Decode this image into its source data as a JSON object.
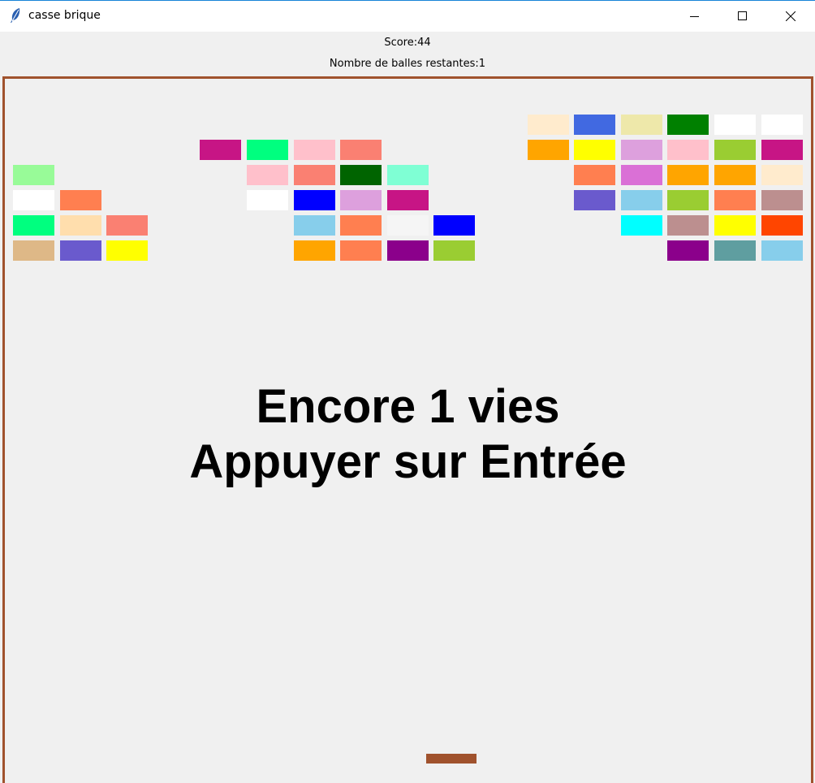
{
  "window": {
    "title": "casse brique",
    "app_icon": "feather-icon",
    "controls": [
      "minimize-icon",
      "maximize-icon",
      "close-icon"
    ]
  },
  "hud": {
    "score": "Score:44",
    "balls_remaining": "Nombre de balles restantes:1"
  },
  "message": {
    "line1": "Encore 1 vies",
    "line2": "Appuyer sur Entrée"
  },
  "colors": {
    "border": "#a0522d",
    "paddle": "#a0522d",
    "background": "#f0f0f0"
  },
  "bricks": [
    {
      "row": 0,
      "col": 11,
      "color": "#ffebcd"
    },
    {
      "row": 0,
      "col": 12,
      "color": "#4169e1"
    },
    {
      "row": 0,
      "col": 13,
      "color": "#eee8aa"
    },
    {
      "row": 0,
      "col": 14,
      "color": "#008000"
    },
    {
      "row": 0,
      "col": 15,
      "color": "#ffffff"
    },
    {
      "row": 0,
      "col": 16,
      "color": "#ffffff"
    },
    {
      "row": 1,
      "col": 4,
      "color": "#c71585"
    },
    {
      "row": 1,
      "col": 5,
      "color": "#00ff7f"
    },
    {
      "row": 1,
      "col": 6,
      "color": "#ffc0cb"
    },
    {
      "row": 1,
      "col": 7,
      "color": "#fa8072"
    },
    {
      "row": 1,
      "col": 11,
      "color": "#ffa500"
    },
    {
      "row": 1,
      "col": 12,
      "color": "#ffff00"
    },
    {
      "row": 1,
      "col": 13,
      "color": "#dda0dd"
    },
    {
      "row": 1,
      "col": 14,
      "color": "#ffc0cb"
    },
    {
      "row": 1,
      "col": 15,
      "color": "#9acd32"
    },
    {
      "row": 1,
      "col": 16,
      "color": "#c71585"
    },
    {
      "row": 2,
      "col": 0,
      "color": "#98fb98"
    },
    {
      "row": 2,
      "col": 5,
      "color": "#ffc0cb"
    },
    {
      "row": 2,
      "col": 6,
      "color": "#fa8072"
    },
    {
      "row": 2,
      "col": 7,
      "color": "#006400"
    },
    {
      "row": 2,
      "col": 8,
      "color": "#7fffd4"
    },
    {
      "row": 2,
      "col": 12,
      "color": "#ff7f50"
    },
    {
      "row": 2,
      "col": 13,
      "color": "#da70d6"
    },
    {
      "row": 2,
      "col": 14,
      "color": "#ffa500"
    },
    {
      "row": 2,
      "col": 15,
      "color": "#ffa500"
    },
    {
      "row": 2,
      "col": 16,
      "color": "#ffebcd"
    },
    {
      "row": 3,
      "col": 0,
      "color": "#ffffff"
    },
    {
      "row": 3,
      "col": 1,
      "color": "#ff7f50"
    },
    {
      "row": 3,
      "col": 5,
      "color": "#ffffff"
    },
    {
      "row": 3,
      "col": 6,
      "color": "#0000ff"
    },
    {
      "row": 3,
      "col": 7,
      "color": "#dda0dd"
    },
    {
      "row": 3,
      "col": 8,
      "color": "#c71585"
    },
    {
      "row": 3,
      "col": 12,
      "color": "#6a5acd"
    },
    {
      "row": 3,
      "col": 13,
      "color": "#87ceeb"
    },
    {
      "row": 3,
      "col": 14,
      "color": "#9acd32"
    },
    {
      "row": 3,
      "col": 15,
      "color": "#ff7f50"
    },
    {
      "row": 3,
      "col": 16,
      "color": "#bc8f8f"
    },
    {
      "row": 4,
      "col": 0,
      "color": "#00ff7f"
    },
    {
      "row": 4,
      "col": 1,
      "color": "#ffdead"
    },
    {
      "row": 4,
      "col": 2,
      "color": "#fa8072"
    },
    {
      "row": 4,
      "col": 6,
      "color": "#87ceeb"
    },
    {
      "row": 4,
      "col": 7,
      "color": "#ff7f50"
    },
    {
      "row": 4,
      "col": 8,
      "color": "#f5f5f5"
    },
    {
      "row": 4,
      "col": 9,
      "color": "#0000ff"
    },
    {
      "row": 4,
      "col": 13,
      "color": "#00ffff"
    },
    {
      "row": 4,
      "col": 14,
      "color": "#bc8f8f"
    },
    {
      "row": 4,
      "col": 15,
      "color": "#ffff00"
    },
    {
      "row": 4,
      "col": 16,
      "color": "#ff4500"
    },
    {
      "row": 5,
      "col": 0,
      "color": "#deb887"
    },
    {
      "row": 5,
      "col": 1,
      "color": "#6a5acd"
    },
    {
      "row": 5,
      "col": 2,
      "color": "#ffff00"
    },
    {
      "row": 5,
      "col": 6,
      "color": "#ffa500"
    },
    {
      "row": 5,
      "col": 7,
      "color": "#ff7f50"
    },
    {
      "row": 5,
      "col": 8,
      "color": "#8b008b"
    },
    {
      "row": 5,
      "col": 9,
      "color": "#9acd32"
    },
    {
      "row": 5,
      "col": 14,
      "color": "#8b008b"
    },
    {
      "row": 5,
      "col": 15,
      "color": "#5f9ea0"
    },
    {
      "row": 5,
      "col": 16,
      "color": "#87ceeb"
    }
  ]
}
